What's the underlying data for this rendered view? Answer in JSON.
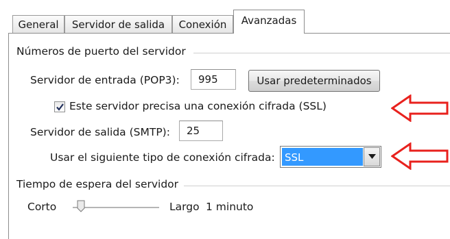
{
  "tabs": [
    {
      "label": "General"
    },
    {
      "label": "Servidor de salida"
    },
    {
      "label": "Conexión"
    },
    {
      "label": "Avanzadas"
    }
  ],
  "ports_group": {
    "title": "Números de puerto del servidor",
    "incoming_label": "Servidor de entrada (POP3):",
    "incoming_value": "995",
    "defaults_button": "Usar predeterminados",
    "ssl_checkbox_label": "Este servidor precisa una conexión cifrada (SSL)",
    "ssl_checked": true,
    "outgoing_label": "Servidor de salida (SMTP):",
    "outgoing_value": "25",
    "encryption_label": "Usar el siguiente tipo de conexión cifrada:",
    "encryption_value": "SSL"
  },
  "timeout_group": {
    "title": "Tiempo de espera del servidor",
    "short_label": "Corto",
    "long_label": "Largo",
    "value_text": "1 minuto",
    "slider_level": 0.08
  },
  "colors": {
    "annotation_arrow": "#e8211d",
    "selection": "#3399ff"
  },
  "icons": {
    "checkbox": "check-icon",
    "dropdown": "chevron-down-icon",
    "annotation": "red-arrow-icon"
  }
}
